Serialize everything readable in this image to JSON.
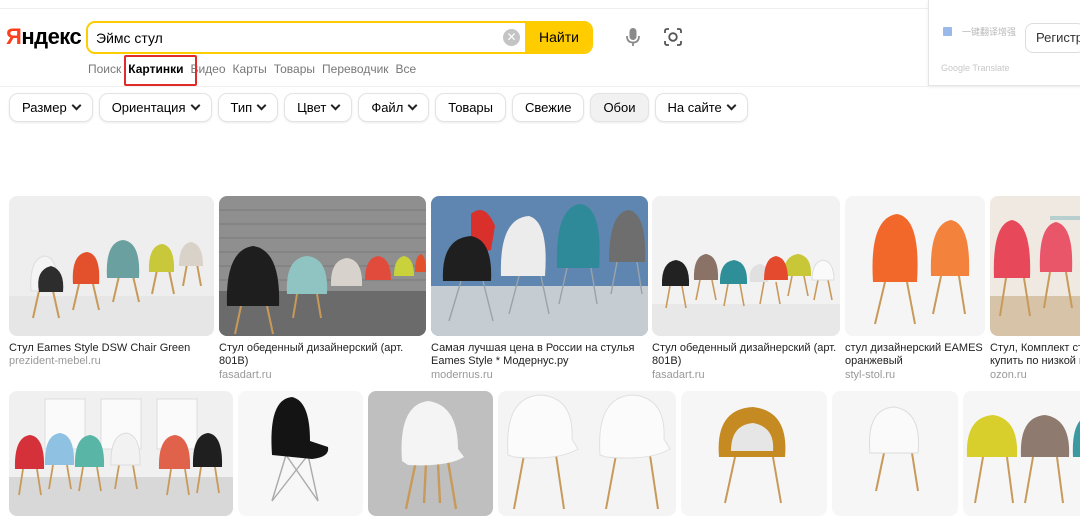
{
  "header": {
    "logo": "Яндекс",
    "search_value": "Эймс стул",
    "find_label": "Найти",
    "register_label": "Регистр"
  },
  "tabs": [
    {
      "label": "Поиск"
    },
    {
      "label": "Картинки",
      "active": true
    },
    {
      "label": "Видео"
    },
    {
      "label": "Карты"
    },
    {
      "label": "Товары"
    },
    {
      "label": "Переводчик"
    },
    {
      "label": "Все"
    }
  ],
  "translate_popup": {
    "option_text": "一键翻译增强",
    "brand": "Google Translate"
  },
  "filters": [
    {
      "label": "Размер",
      "dropdown": true
    },
    {
      "label": "Ориентация",
      "dropdown": true
    },
    {
      "label": "Тип",
      "dropdown": true
    },
    {
      "label": "Цвет",
      "dropdown": true
    },
    {
      "label": "Файл",
      "dropdown": true
    },
    {
      "label": "Товары",
      "dropdown": false
    },
    {
      "label": "Свежие",
      "dropdown": false
    },
    {
      "label": "Обои",
      "dropdown": false,
      "selected": true
    },
    {
      "label": "На сайте",
      "dropdown": true
    }
  ],
  "results": [
    {
      "caption": "Стул Eames Style DSW Chair Green",
      "source": "prezident-mebel.ru"
    },
    {
      "caption": "Стул обеденный дизайнерский (арт. 801B)",
      "source": "fasadart.ru"
    },
    {
      "caption": "Самая лучшая цена в России на стулья Eames Style * Модернус.ру",
      "source": "modernus.ru"
    },
    {
      "caption": "Стул обеденный дизайнерский (арт. 801B)",
      "source": "fasadart.ru"
    },
    {
      "caption": "стул дизайнерский EAMES оранжевый",
      "source": "styl-stol.ru"
    },
    {
      "caption": "Стул, Комплект стулье купить по низкой це",
      "source": "ozon.ru"
    }
  ],
  "colors": {
    "brand_red": "#fc3f1d",
    "accent_yellow": "#ffcc00",
    "highlight_red": "#e12a2a"
  }
}
